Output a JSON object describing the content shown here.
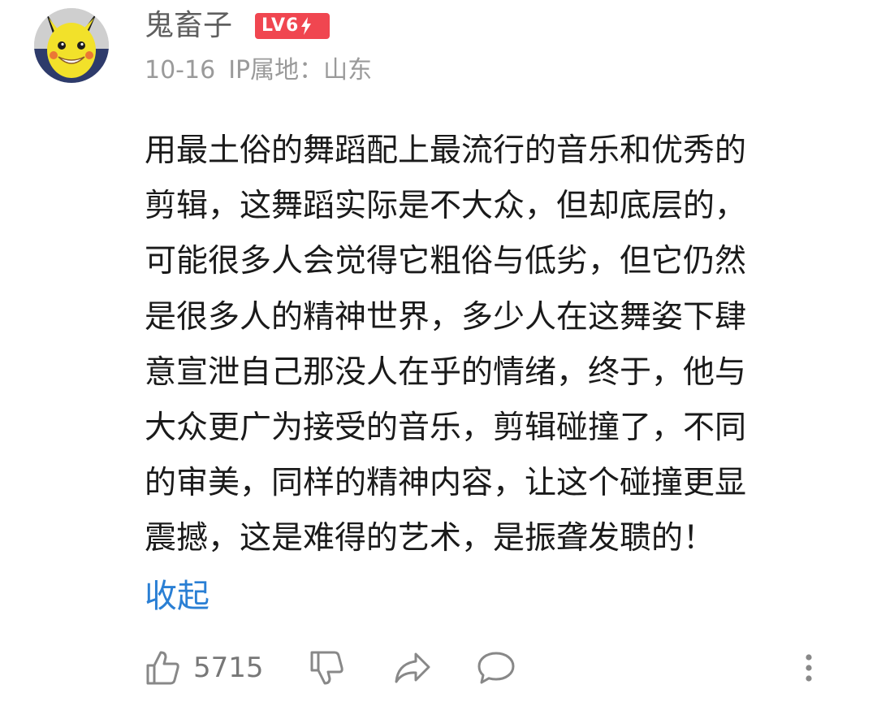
{
  "user": {
    "name": "鬼畜子",
    "level_label": "LV6",
    "avatar_icon": "pikachu-avatar"
  },
  "meta": {
    "date": "10-16",
    "ip_location": "IP属地：山东"
  },
  "comment": {
    "text": "用最土俗的舞蹈配上最流行的音乐和优秀的\n剪辑，这舞蹈实际是不大众，但却底层的，\n可能很多人会觉得它粗俗与低劣，但它仍然\n是很多人的精神世界，多少人在这舞姿下肆\n意宣泄自己那没人在乎的情绪，终于，他与\n大众更广为接受的音乐，剪辑碰撞了，不同\n的审美，同样的精神内容，让这个碰撞更显\n震撼，这是难得的艺术，是振聋发聩的！",
    "collapse_label": "收起"
  },
  "actions": {
    "like_count": "5715",
    "like_icon": "thumbs-up-icon",
    "dislike_icon": "thumbs-down-icon",
    "share_icon": "share-icon",
    "reply_icon": "comment-bubble-icon",
    "more_icon": "more-vertical-icon"
  },
  "colors": {
    "badge": "#f04650",
    "link": "#2a7fd4",
    "avatar_yellow": "#f2e12a"
  }
}
